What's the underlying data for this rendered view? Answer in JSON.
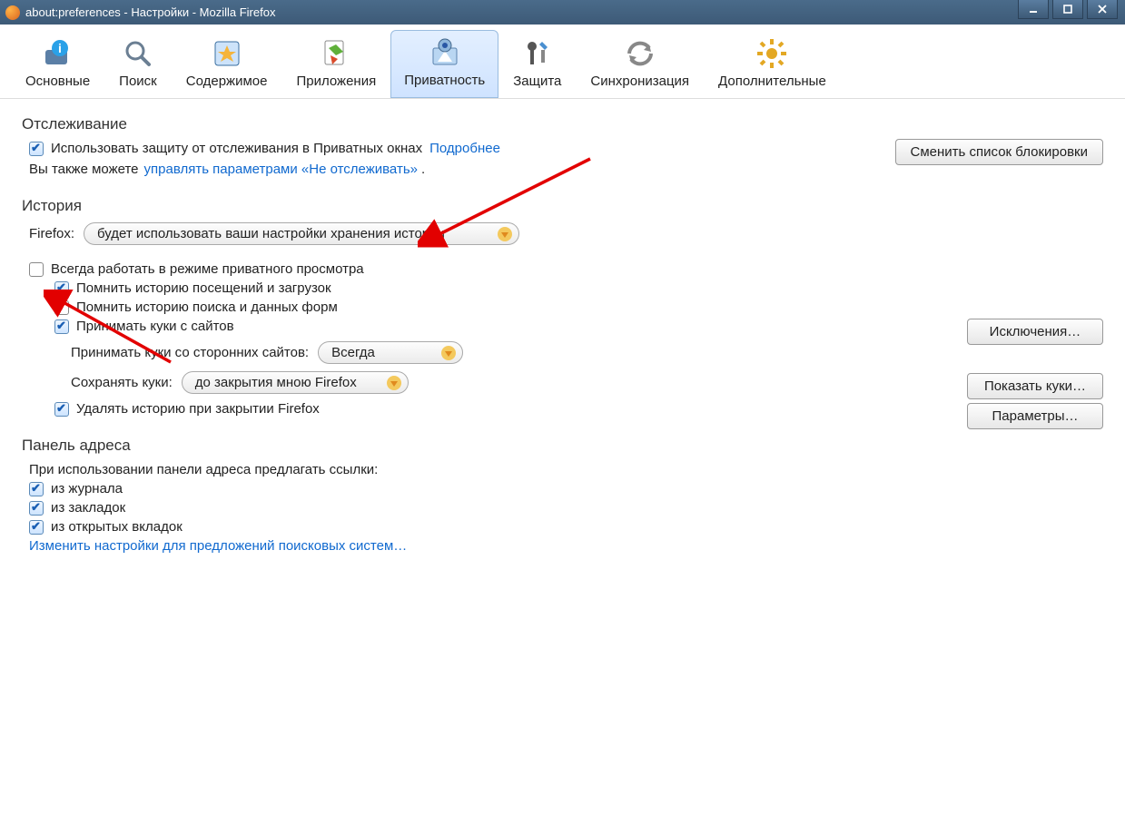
{
  "window": {
    "title": "about:preferences - Настройки - Mozilla Firefox"
  },
  "toolbar": {
    "items": [
      {
        "label": "Основные"
      },
      {
        "label": "Поиск"
      },
      {
        "label": "Содержимое"
      },
      {
        "label": "Приложения"
      },
      {
        "label": "Приватность"
      },
      {
        "label": "Защита"
      },
      {
        "label": "Синхронизация"
      },
      {
        "label": "Дополнительные"
      }
    ]
  },
  "tracking": {
    "heading": "Отслеживание",
    "use_protection": "Использовать защиту от отслеживания в Приватных окнах",
    "learn_more": "Подробнее",
    "also_prefix": "Вы также можете",
    "also_link": "управлять параметрами «Не отслеживать»",
    "also_suffix": ".",
    "change_blocklist_btn": "Сменить список блокировки"
  },
  "history": {
    "heading": "История",
    "firefox_label": "Firefox:",
    "mode": "будет использовать ваши настройки хранения истории",
    "always_private": "Всегда работать в режиме приватного просмотра",
    "remember_browsing": "Помнить историю посещений и загрузок",
    "remember_search": "Помнить историю поиска и данных форм",
    "accept_cookies": "Принимать куки с сайтов",
    "third_party_label": "Принимать куки со сторонних сайтов:",
    "third_party_value": "Всегда",
    "keep_until_label": "Сохранять куки:",
    "keep_until_value": "до закрытия мною Firefox",
    "clear_on_close": "Удалять историю при закрытии Firefox",
    "exceptions_btn": "Исключения…",
    "show_cookies_btn": "Показать куки…",
    "settings_btn": "Параметры…"
  },
  "addressbar": {
    "heading": "Панель адреса",
    "intro": "При использовании панели адреса предлагать ссылки:",
    "from_history": "из журнала",
    "from_bookmarks": "из закладок",
    "from_open_tabs": "из открытых вкладок",
    "change_search_link": "Изменить настройки для предложений поисковых систем…"
  }
}
